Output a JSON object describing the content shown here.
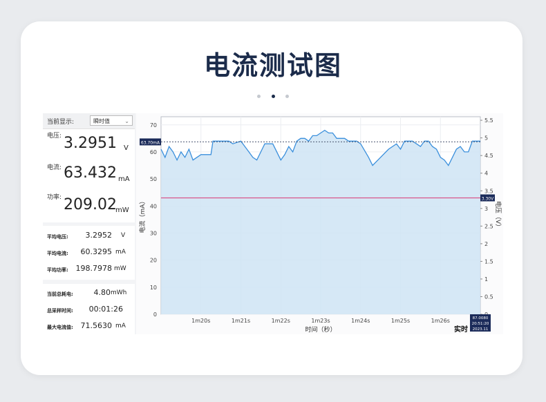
{
  "page": {
    "title": "电流测试图",
    "carousel": {
      "count": 3,
      "active_index": 1
    }
  },
  "display_select": {
    "label": "当前显示:",
    "value": "瞬时值"
  },
  "instant": {
    "voltage": {
      "label": "电压:",
      "value": "3.2951",
      "unit": "V"
    },
    "current": {
      "label": "电流:",
      "value": "63.432",
      "unit": "mA"
    },
    "power": {
      "label": "功率:",
      "value": "209.02",
      "unit": "mW"
    }
  },
  "averages": [
    {
      "label": "平均电压:",
      "value": "3.2952",
      "unit": "V"
    },
    {
      "label": "平均电流:",
      "value": "60.3295",
      "unit": "mA"
    },
    {
      "label": "平均功率:",
      "value": "198.7978",
      "unit": "mW"
    }
  ],
  "totals": [
    {
      "label": "当前总耗电:",
      "value": "4.80",
      "unit": "mWh"
    },
    {
      "label": "总采样时间:",
      "value": "00:01:26",
      "unit": ""
    },
    {
      "label": "最大电流值:",
      "value": "71.5630",
      "unit": "mA"
    }
  ],
  "mode_label": "实时",
  "chart_data": {
    "type": "area",
    "xlabel": "时间（秒）",
    "ylabel": "电流（mA）",
    "y2label": "电压（V）",
    "x_ticks": [
      "1m20s",
      "1m21s",
      "1m22s",
      "1m23s",
      "1m24s",
      "1m25s",
      "1m26s"
    ],
    "x_tick_seconds": [
      80,
      81,
      82,
      83,
      84,
      85,
      86
    ],
    "xlim": [
      79.0,
      87.0
    ],
    "ylim": [
      0,
      73
    ],
    "y_ticks": [
      0,
      10,
      20,
      30,
      40,
      50,
      60,
      70
    ],
    "y2lim": [
      0,
      5.6
    ],
    "y2_ticks": [
      "0",
      "0.5",
      "1",
      "1.5",
      "2",
      "2.5",
      "3",
      "3.5",
      "4",
      "4.5",
      "5",
      "5.5"
    ],
    "grid": true,
    "current_marker": {
      "label": "63.70mA",
      "value": 63.7
    },
    "voltage_marker": {
      "label": "3.30V",
      "value": 3.3
    },
    "cursor_readout": [
      "87.0080",
      "20:51:20",
      "2023.11"
    ],
    "colors": {
      "current": "#3a8fdc",
      "fill": "#cfe4f5",
      "voltage": "#d9538a",
      "marker": "#1b2b5a"
    },
    "series": [
      {
        "name": "电流",
        "x": [
          79.0,
          79.1,
          79.2,
          79.3,
          79.4,
          79.5,
          79.6,
          79.7,
          79.8,
          80.0,
          80.2,
          80.25,
          80.3,
          80.5,
          80.7,
          80.8,
          81.0,
          81.1,
          81.2,
          81.3,
          81.4,
          81.6,
          81.8,
          82.0,
          82.1,
          82.2,
          82.3,
          82.4,
          82.5,
          82.6,
          82.7,
          82.8,
          82.9,
          83.0,
          83.1,
          83.2,
          83.3,
          83.4,
          83.5,
          83.6,
          83.7,
          83.8,
          83.9,
          84.0,
          84.2,
          84.3,
          84.5,
          84.7,
          84.9,
          85.0,
          85.1,
          85.2,
          85.3,
          85.4,
          85.5,
          85.6,
          85.7,
          85.8,
          85.9,
          86.0,
          86.1,
          86.2,
          86.3,
          86.4,
          86.5,
          86.6,
          86.7,
          86.8,
          86.9,
          87.0
        ],
        "values": [
          61,
          58,
          62,
          60,
          57,
          60,
          58,
          61,
          57,
          59,
          59,
          59,
          64,
          64,
          64,
          63,
          64,
          62,
          60,
          58,
          57,
          63,
          63,
          57,
          59,
          62,
          60,
          64,
          65,
          65,
          64,
          66,
          66,
          67,
          68,
          67,
          67,
          65,
          65,
          65,
          64,
          64,
          64,
          63,
          58,
          55,
          58,
          61,
          63,
          61,
          64,
          64,
          64,
          63,
          62,
          64,
          64,
          62,
          61,
          58,
          57,
          55,
          58,
          61,
          62,
          60,
          60,
          64,
          64,
          64
        ]
      },
      {
        "name": "电压",
        "x": [
          79.0,
          87.0
        ],
        "values": [
          3.3,
          3.3
        ]
      }
    ]
  }
}
